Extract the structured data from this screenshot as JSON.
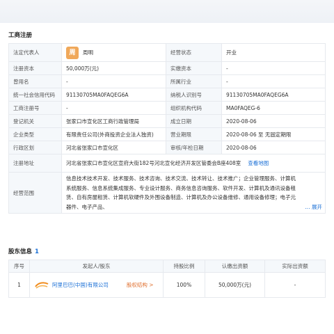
{
  "section_registration": {
    "title": "工商注册"
  },
  "rows": [
    {
      "k1": "法定代表人",
      "v1": "周明",
      "avatar": "周",
      "k2": "经营状态",
      "v2": "开业"
    },
    {
      "k1": "注册资本",
      "v1": "50,000万(元)",
      "k2": "实缴资本",
      "v2": "-"
    },
    {
      "k1": "曾用名",
      "v1": "-",
      "k2": "所属行业",
      "v2": "-"
    },
    {
      "k1": "统一社会信用代码",
      "v1": "91130705MA0FAQEG6A",
      "k2": "纳税人识别号",
      "v2": "91130705MA0FAQEG6A"
    },
    {
      "k1": "工商注册号",
      "v1": "-",
      "k2": "组织机构代码",
      "v2": "MA0FAQEG-6"
    },
    {
      "k1": "登记机关",
      "v1": "张家口市宣化区工商行政管理局",
      "k2": "成立日期",
      "v2": "2020-08-06"
    },
    {
      "k1": "企业类型",
      "v1": "有限责任公司(外商投资企业法人独资)",
      "k2": "营业期限",
      "v2": "2020-08-06 至 无固定期限"
    },
    {
      "k1": "行政区划",
      "v1": "河北省张家口市宣化区",
      "k2": "审核/年检日期",
      "v2": "2020-08-06"
    }
  ],
  "address": {
    "label": "注册地址",
    "value": "河北省张家口市宣化区宣府大街182号河北宣化经济开发区管委会B座408室",
    "map_link": "查看地图"
  },
  "scope": {
    "label": "经营范围",
    "value": "信息技术技术开发、技术服务、技术咨询、技术交流、技术转让、技术推广；企业管理服务、计算机系统服务、信息系统集成服务、专业设计服务、商务信息咨询服务、软件开发、计算机及通讯设备租赁、自有房屋租赁、计算机软硬件及外围设备制造、计算机及办公设备维修、通用设备修理；电子元器件、电子产品、",
    "expand": "展开"
  },
  "section_shareholders": {
    "title": "股东信息",
    "count": "1"
  },
  "holders_table": {
    "headers": [
      "序号",
      "发起人/股东",
      "持股比例",
      "认缴出资额",
      "实际出资额"
    ],
    "rows": [
      {
        "index": "1",
        "name": "阿里巴巴(中国)有限公司",
        "equity_link": "股权结构 >",
        "ratio": "100%",
        "subscribed": "50,000万(元)",
        "paid": "-"
      }
    ]
  }
}
